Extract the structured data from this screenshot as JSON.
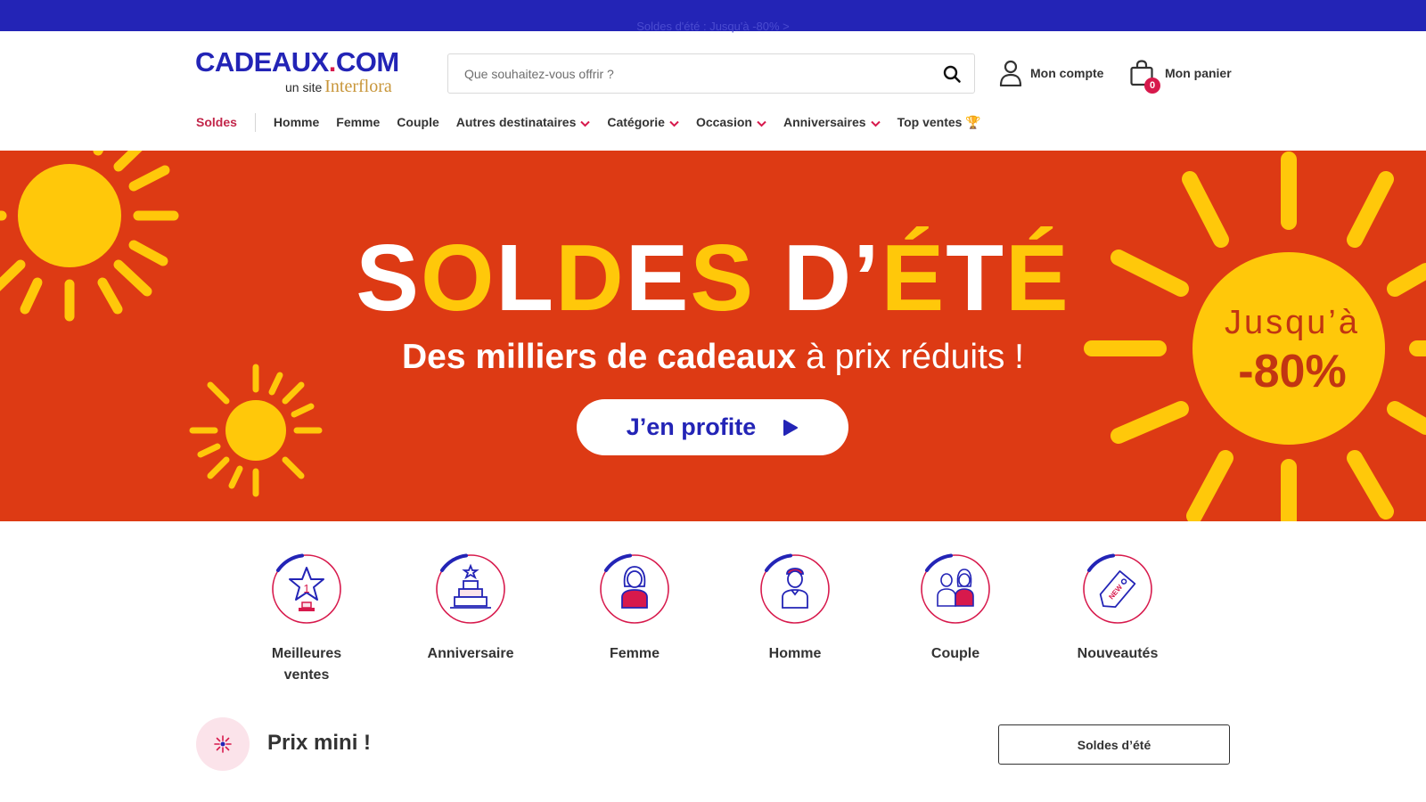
{
  "topbar": {
    "promo_text": "Soldes d'été : Jusqu'à -80% >"
  },
  "header": {
    "logo": {
      "main_a": "CADEAUX",
      "main_dot": ".",
      "main_b": "COM",
      "sub_a": "un site",
      "sub_b": "Interflora"
    },
    "search": {
      "placeholder": "Que souhaitez-vous offrir ?",
      "value": ""
    },
    "account": {
      "label": "Mon compte"
    },
    "cart": {
      "label": "Mon panier",
      "count": "0"
    }
  },
  "nav": {
    "items": [
      {
        "label": "Soldes"
      },
      {
        "label": "Homme"
      },
      {
        "label": "Femme"
      },
      {
        "label": "Couple"
      },
      {
        "label": "Autres destinataires"
      },
      {
        "label": "Catégorie"
      },
      {
        "label": "Occasion"
      },
      {
        "label": "Anniversaires"
      },
      {
        "label": "Top ventes 🏆"
      }
    ]
  },
  "hero": {
    "title_letters": [
      "S",
      "O",
      "L",
      "D",
      "E",
      "S",
      " ",
      "D",
      "’",
      "É",
      "T",
      "É"
    ],
    "subtitle_bold": "Des milliers de cadeaux",
    "subtitle_rest": " à prix réduits !",
    "cta_label": "J’en profite",
    "promo_line1": "Jusqu’à",
    "promo_line2": "-80%"
  },
  "categories": [
    {
      "label": "Meilleures ventes",
      "icon": "trophy-star-icon"
    },
    {
      "label": "Anniversaire",
      "icon": "cake-icon"
    },
    {
      "label": "Femme",
      "icon": "woman-icon"
    },
    {
      "label": "Homme",
      "icon": "man-icon"
    },
    {
      "label": "Couple",
      "icon": "couple-icon"
    },
    {
      "label": "Nouveautés",
      "icon": "new-tag-icon"
    }
  ],
  "section": {
    "title": "Prix mini !",
    "button_label": "Soldes d’été",
    "icon": "firework-icon"
  },
  "colors": {
    "brand_blue": "#2324b6",
    "brand_pink": "#d7194c",
    "hero_red": "#dd3a14",
    "sun_yellow": "#ffc80a"
  }
}
